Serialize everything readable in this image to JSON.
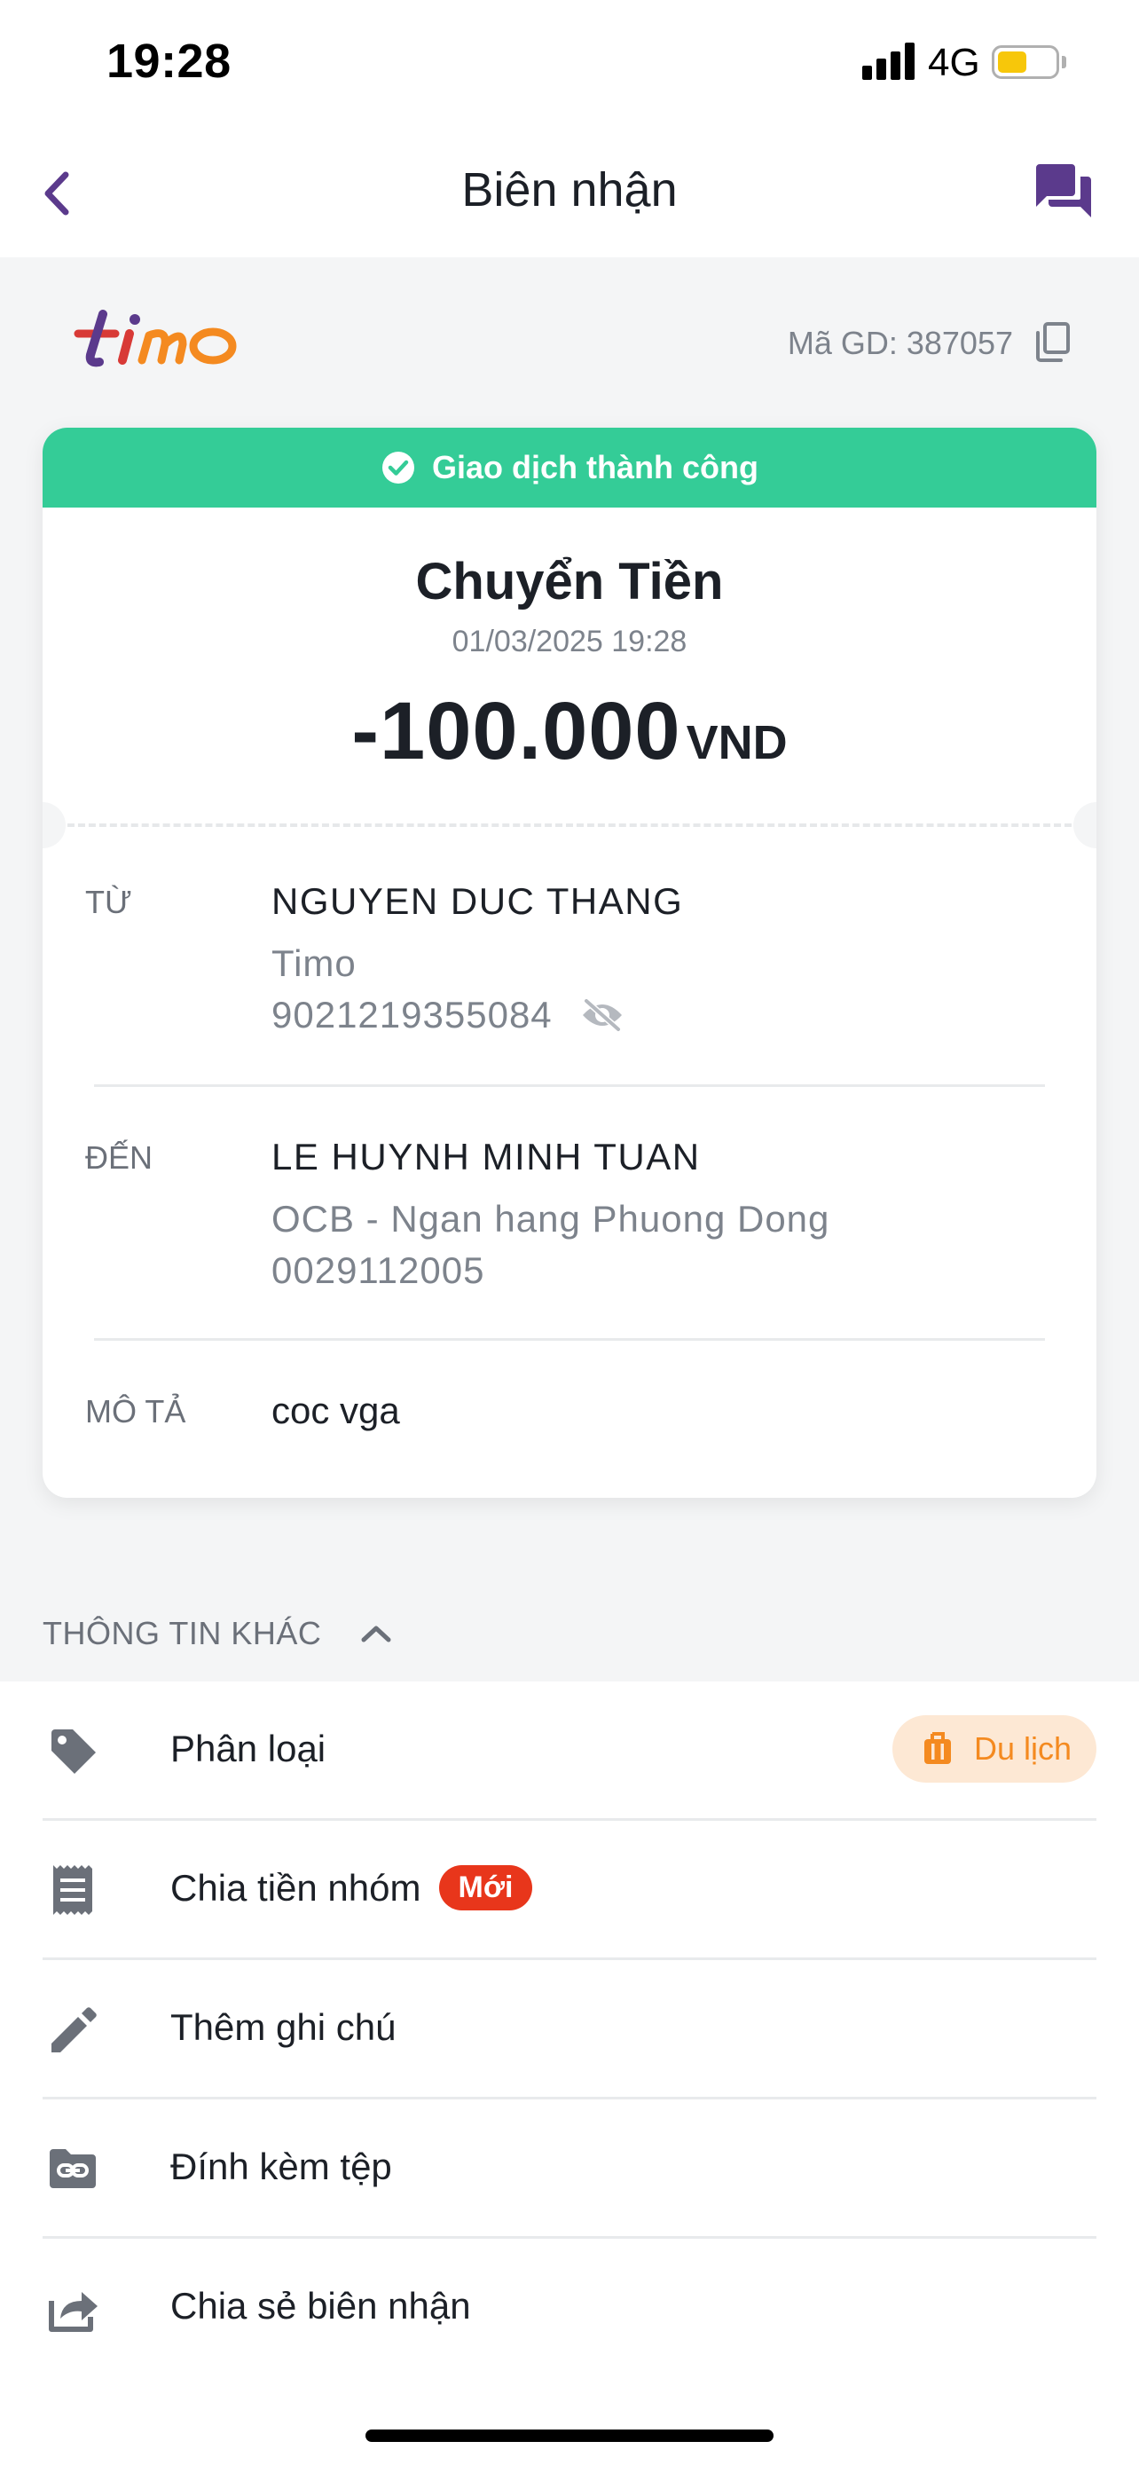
{
  "status_bar": {
    "time": "19:28",
    "network": "4G"
  },
  "nav": {
    "title": "Biên nhận"
  },
  "brand": {
    "logo_text": "timo",
    "transaction_id": "Mã GD: 387057"
  },
  "receipt": {
    "status": "Giao dịch thành công",
    "title": "Chuyển Tiền",
    "datetime": "01/03/2025 19:28",
    "amount": "-100.000",
    "currency": "VND",
    "from": {
      "label": "TỪ",
      "name": "NGUYEN DUC THANG",
      "bank": "Timo",
      "account": "9021219355084"
    },
    "to": {
      "label": "ĐẾN",
      "name": "LE HUYNH MINH TUAN",
      "bank": "OCB - Ngan hang Phuong Dong",
      "account": "0029112005"
    },
    "description": {
      "label": "MÔ TẢ",
      "text": "coc vga"
    }
  },
  "other_info": {
    "header": "THÔNG TIN KHÁC",
    "items": [
      {
        "label": "Phân loại",
        "icon": "tag-icon",
        "tag": "Du lịch",
        "tag_icon": "luggage-icon"
      },
      {
        "label": "Chia tiền nhóm",
        "icon": "receipt-icon",
        "badge": "Mới"
      },
      {
        "label": "Thêm ghi chú",
        "icon": "pencil-icon"
      },
      {
        "label": "Đính kèm tệp",
        "icon": "folder-link-icon"
      },
      {
        "label": "Chia sẻ biên nhận",
        "icon": "share-icon"
      }
    ]
  },
  "colors": {
    "brand_purple": "#5b3a8c",
    "success_green": "#34cc97",
    "badge_red": "#e8361b",
    "tag_orange": "#f48a20",
    "tag_bg": "#fde8d4",
    "icon_gray": "#6b7079"
  }
}
